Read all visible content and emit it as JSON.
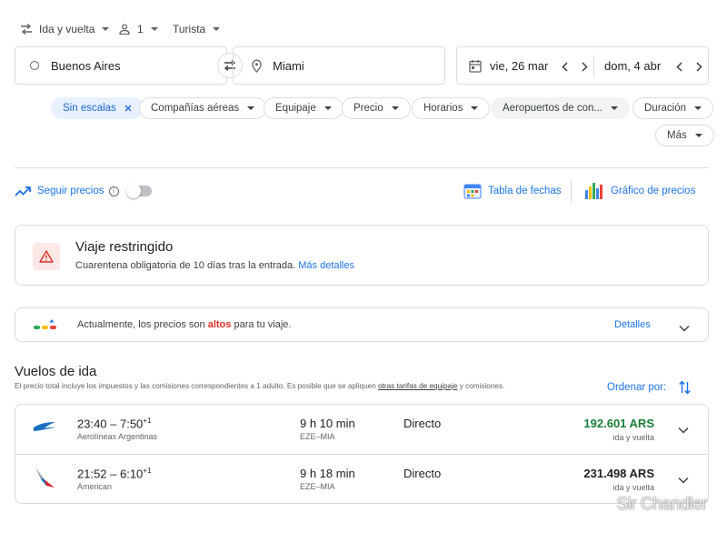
{
  "top": {
    "trip_type": "Ida y vuelta",
    "passengers": "1",
    "cabin": "Turista"
  },
  "search": {
    "origin": "Buenos Aires",
    "destination": "Miami",
    "depart_date": "vie, 26 mar",
    "return_date": "dom, 4 abr"
  },
  "filters": {
    "nonstop": "Sin escalas",
    "airlines": "Compañías aéreas",
    "bags": "Equipaje",
    "price": "Precio",
    "times": "Horarios",
    "airports": "Aeropuertos de con...",
    "duration": "Duración",
    "more": "Más"
  },
  "tools": {
    "track_prices": "Seguir precios",
    "date_grid": "Tabla de fechas",
    "price_graph": "Gráfico de precios"
  },
  "restriction": {
    "title": "Viaje restringido",
    "text": "Cuarentena obligatoria de 10 días tras la entrada.",
    "link": "Más detalles"
  },
  "price_insight": {
    "text_before": "Actualmente, los precios son",
    "level": "altos",
    "text_after": "para tu viaje.",
    "details": "Detalles"
  },
  "results": {
    "title": "Vuelos de ida",
    "note_before": "El precio total incluye los impuestos y las comisiones correspondientes a 1 adulto. Es posible que se apliquen",
    "note_link": "otras tarifas de equipaje",
    "note_after": "y comisiones.",
    "sort_label": "Ordenar por:"
  },
  "flights": [
    {
      "times": "23:40 – 7:50",
      "day_offset": "+1",
      "airline": "Aerolíneas Argentinas",
      "duration": "9 h 10 min",
      "route": "EZE–MIA",
      "stops": "Directo",
      "price": "192.601 ARS",
      "price_color": "#188038",
      "fare_type": "ida y vuelta"
    },
    {
      "times": "21:52 – 6:10",
      "day_offset": "+1",
      "airline": "American",
      "duration": "9 h 18 min",
      "route": "EZE–MIA",
      "stops": "Directo",
      "price": "231.498 ARS",
      "price_color": "#202124",
      "fare_type": "ida y vuelta"
    }
  ],
  "watermark": "Sir Chandler",
  "colors": {
    "accent": "#1a73e8",
    "high_price": "#d93025",
    "good_price": "#188038"
  }
}
